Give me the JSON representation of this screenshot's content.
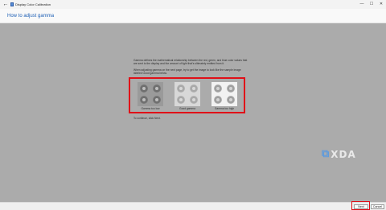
{
  "window": {
    "title": "Display Color Calibration",
    "back_glyph": "←",
    "controls": {
      "minimize": "—",
      "maximize": "☐",
      "close": "✕"
    }
  },
  "header": {
    "title": "How to adjust gamma"
  },
  "main": {
    "description": "Gamma defines the mathematical relationship between the red, green, and blue color values that are sent to the display and the amount of light that's ultimately emitted from it.",
    "instruction": "When adjusting gamma on the next page, try to get the image to look like the sample image labeled Good gamma below.",
    "samples": [
      {
        "caption": "Gamma too low",
        "background": "#9a9a9a",
        "dot_color": "#6f6f6f"
      },
      {
        "caption": "Good gamma",
        "background": "#d8d8d8",
        "dot_color": "#a9a9a9"
      },
      {
        "caption": "Gamma too high",
        "background": "#f2f2f2",
        "dot_color": "#9f9f9f"
      }
    ],
    "continue_text": "To continue, click Next."
  },
  "watermark": {
    "mark": "⧉",
    "text": "XDA"
  },
  "footer": {
    "next_label": "Next",
    "cancel_label": "Cancel"
  },
  "colors": {
    "highlight_border": "#e01018",
    "header_link": "#1d5fb5",
    "content_bg": "#ababab",
    "logo_accent": "#5f9bdc"
  },
  "icons": {
    "back": "back-arrow-icon",
    "app": "display-color-calibration-icon",
    "minimize": "minimize-icon",
    "maximize": "maximize-icon",
    "close": "close-icon"
  }
}
